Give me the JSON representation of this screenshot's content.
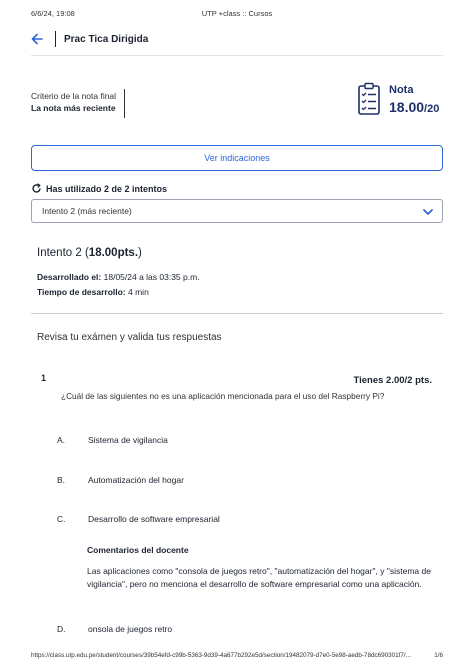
{
  "print_header": {
    "date": "6/6/24, 19:08",
    "tab_title": "UTP +class :: Cursos"
  },
  "topbar": {
    "title": "Prac Tica Dirigida"
  },
  "criteria": {
    "label": "Criterio de la nota final",
    "value": "La nota más reciente"
  },
  "grade": {
    "label": "Nota",
    "value": "18.00",
    "out_of": "/20"
  },
  "instructions_button": {
    "label": "Ver indicaciones"
  },
  "attempts": {
    "text": "Has utilizado 2 de 2 intentos",
    "selected": "Intento 2 (más reciente)"
  },
  "attempt": {
    "title": "Intento 2 (",
    "points": "18.00pts.",
    "title_end": ")",
    "developed_label": "Desarrollado el:",
    "developed_value": "18/05/24 a las 03:35 p.m.",
    "duration_label": "Tiempo de desarrollo:",
    "duration_value": "4 min"
  },
  "review": {
    "title": "Revisa tu exámen y valida tus respuestas"
  },
  "question": {
    "number": "1",
    "score": "Tienes 2.00/2 pts.",
    "text": "¿Cuál de las siguientes no es una aplicación mencionada para el uso del Raspberry Pi?",
    "options": [
      {
        "letter": "A.",
        "text": "Sistema de vigilancia"
      },
      {
        "letter": "B.",
        "text": "Automatización del hogar"
      },
      {
        "letter": "C.",
        "text": "Desarrollo de software empresarial"
      },
      {
        "letter": "D.",
        "text": "onsola de juegos retro"
      }
    ],
    "feedback_title": "Comentarios del docente",
    "feedback_text": "Las aplicaciones como \"consola de juegos retro\", \"automatización del hogar\", y \"sistema de vigilancia\", pero no menciona el desarrollo de software empresarial como una aplicación."
  },
  "print_footer": {
    "url": "https://class.utp.edu.pe/student/courses/39b54efd-c99b-5363-9d39-4a677b292e5d/section/19482079-d7e0-5e98-aedb-78dc690301f7/devaluation…",
    "page": "1/6"
  },
  "colors": {
    "accent": "#2f67d9",
    "grade": "#1e2f6a"
  }
}
